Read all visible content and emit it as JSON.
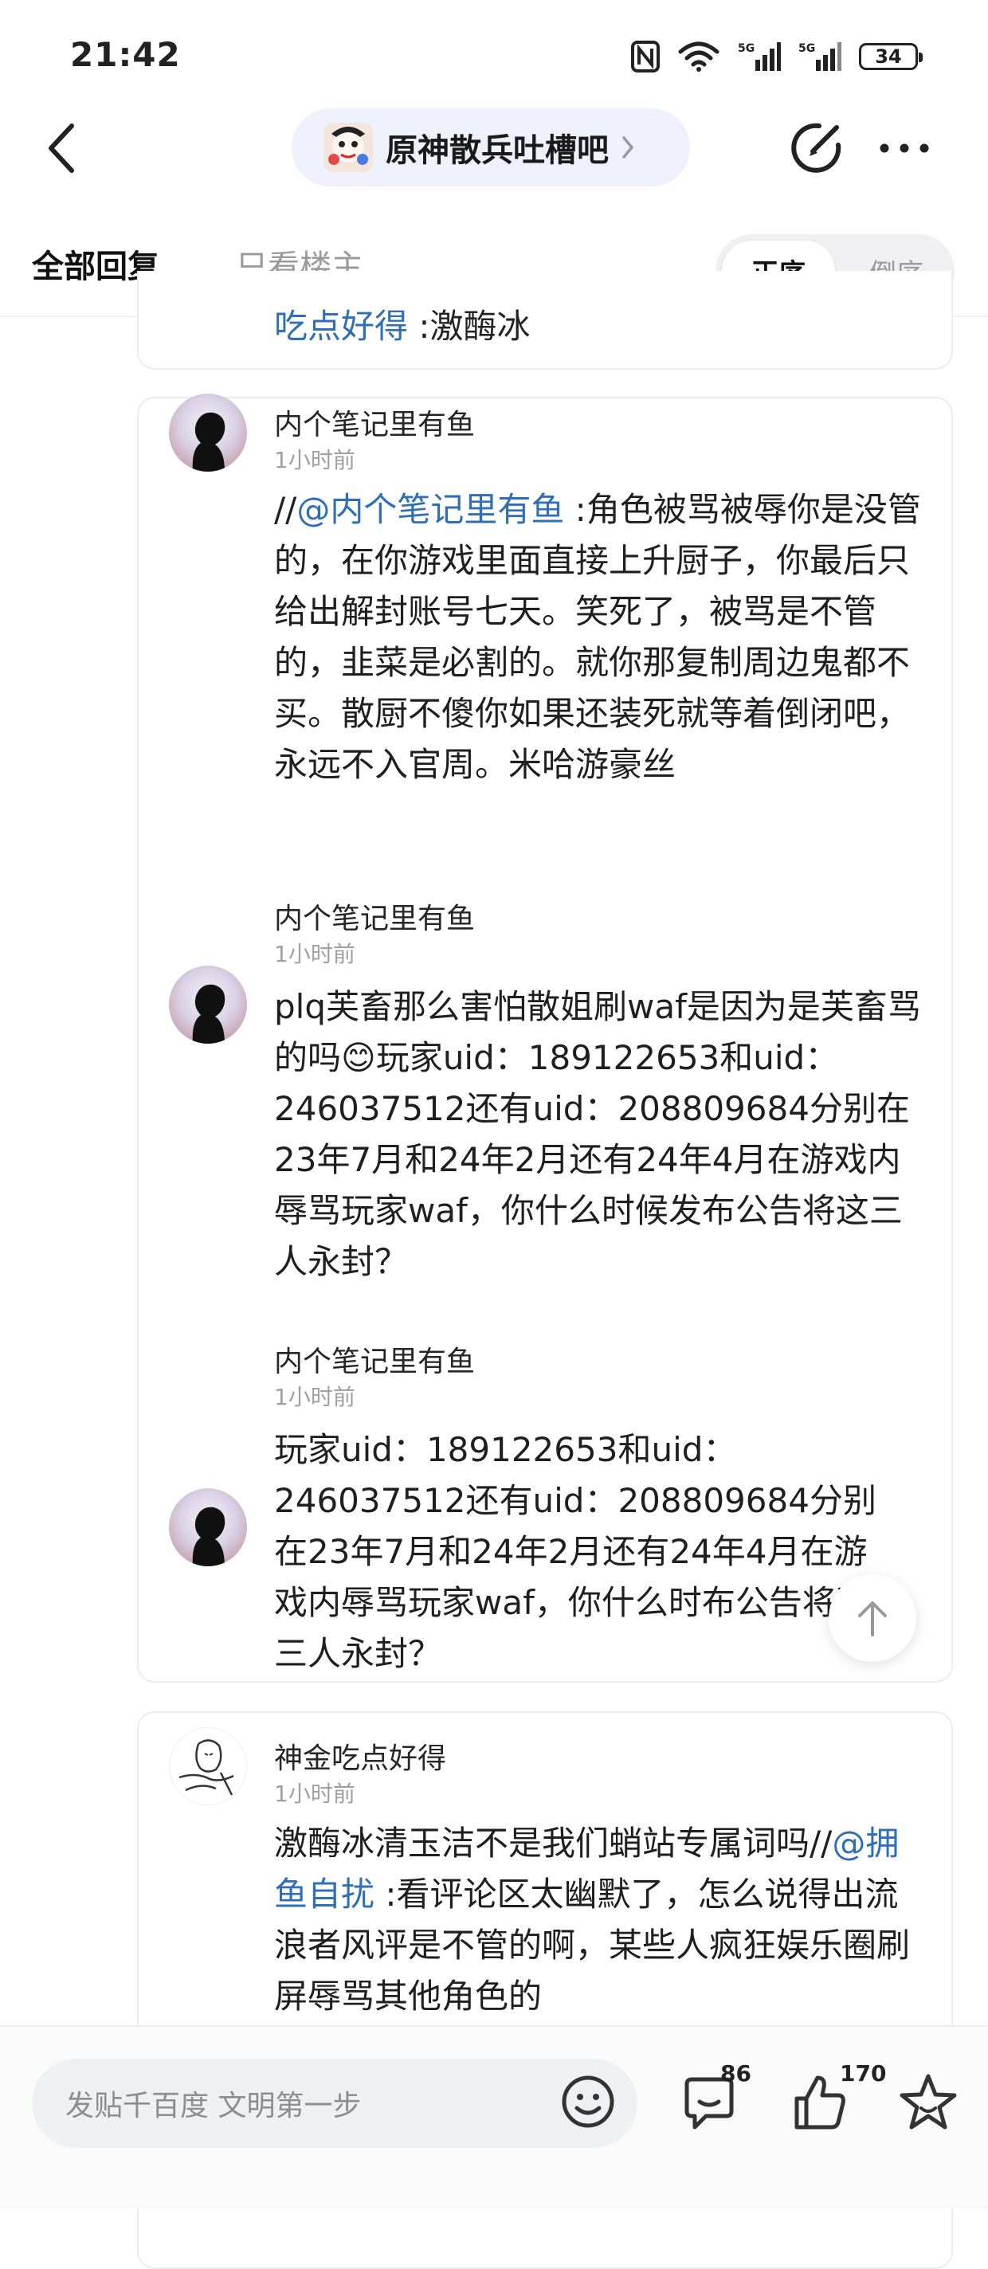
{
  "status_bar": {
    "time": "21:42",
    "battery": "34",
    "icons": [
      "nfc-icon",
      "wifi-icon",
      "signal-5g-icon",
      "signal-5g-icon",
      "battery-icon"
    ]
  },
  "header": {
    "forum_name": "原神散兵吐槽吧",
    "icons": [
      "back-icon",
      "forum-avatar",
      "chevron-right-icon",
      "edit-icon",
      "more-icon"
    ]
  },
  "tabs": {
    "all_replies": "全部回复",
    "only_op": "只看楼主",
    "order_asc": "正序",
    "order_desc": "倒序"
  },
  "top_card": {
    "link": "吃点好得",
    "text": " :激酶冰"
  },
  "main_card": {
    "posts": [
      {
        "user": "内个笔记里有鱼",
        "time": "1小时前",
        "prefix": "//",
        "mention": "@内个笔记里有鱼",
        "body": " :角色被骂被辱你是没管的，在你游戏里面直接上升厨子，你最后只给出解封账号七天。笑死了，被骂是不管的，韭菜是必割的。就你那复制周边鬼都不买。散厨不傻你如果还装死就等着倒闭吧，永远不入官周。米哈游豪丝"
      },
      {
        "user": "内个笔记里有鱼",
        "time": "1小时前",
        "body_a": "plq芙畜那么害怕散姐刷waf是因为是芙畜骂的吗",
        "emoji": "😊",
        "body_b": "玩家uid：189122653和uid：246037512还有uid：208809684分别在23年7月和24年2月还有24年4月在游戏内辱骂玩家waf，你什么时候发布公告将这三人永封？"
      },
      {
        "user": "内个笔记里有鱼",
        "time": "1小时前",
        "body": "玩家uid：189122653和uid：246037512还有uid：208809684分别在23年7月和24年2月还有24年4月在游戏内辱骂玩家waf，你什么时布公告将这三人永封？"
      }
    ]
  },
  "bottom_card": {
    "user": "神金吃点好得",
    "time": "1小时前",
    "body_a": "激酶冰清玉洁不是我们蛸站专属词吗//",
    "mention": "@拥鱼自扰",
    "body_b": " :看评论区太幽默了，怎么说得出流浪者风评是不管的啊，某些人疯狂娱乐圈刷屏辱骂其他角色的"
  },
  "bottom_bar": {
    "reply_placeholder": "发贴千百度 文明第一步",
    "comment_count": "86",
    "like_count": "170",
    "icons": [
      "emoji-icon",
      "comment-icon",
      "like-icon",
      "star-icon"
    ]
  }
}
